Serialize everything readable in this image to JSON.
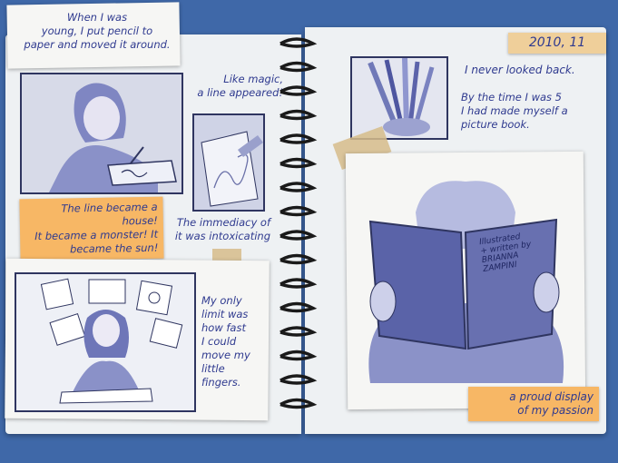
{
  "left": {
    "intro": [
      "When I was",
      "young, I put pencil to",
      "paper and moved it around."
    ],
    "magic": [
      "Like magic,",
      "a line appeared!"
    ],
    "note": [
      "The line became a house!",
      "It became a monster! It",
      "became the sun!"
    ],
    "immediacy": [
      "The immediacy of",
      "it was intoxicating"
    ],
    "limit": [
      "My only",
      "limit was",
      "how fast",
      "I could",
      "move my",
      "little",
      "fingers."
    ]
  },
  "right": {
    "date": "2010, 11",
    "never": "I never looked back.",
    "by_five": [
      "By the time I was 5",
      "I had made myself a",
      "picture book."
    ],
    "book_cover": [
      "Illustrated",
      "+ written by",
      "BRIANNA",
      "ZAMPINI"
    ],
    "note": [
      "a proud display",
      "of my passion"
    ]
  },
  "colors": {
    "background": "#3f68a8",
    "ink": "#2f3a8f",
    "note": "#f7b765",
    "page": "#eef1f3"
  }
}
